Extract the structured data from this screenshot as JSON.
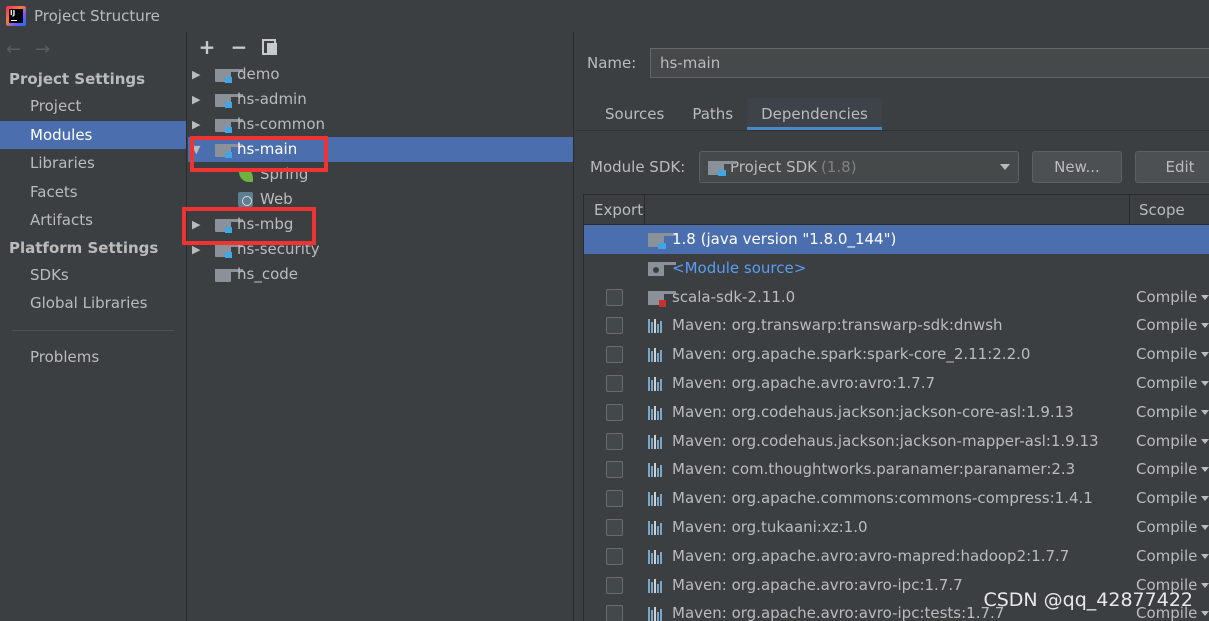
{
  "window": {
    "title": "Project Structure"
  },
  "nav": {
    "back_arrow": "←",
    "forward_arrow": "→",
    "project_settings_header": "Project Settings",
    "project_settings_items": [
      "Project",
      "Modules",
      "Libraries",
      "Facets",
      "Artifacts"
    ],
    "selected_item": "Modules",
    "platform_settings_header": "Platform Settings",
    "platform_settings_items": [
      "SDKs",
      "Global Libraries"
    ],
    "problems": "Problems"
  },
  "tree_toolbar": {
    "add": "+",
    "remove": "−"
  },
  "modules": [
    {
      "label": "demo",
      "expandable": true
    },
    {
      "label": "hs-admin",
      "expandable": true
    },
    {
      "label": "hs-common",
      "expandable": true
    },
    {
      "label": "hs-main",
      "expanded": true,
      "selected": true,
      "highlighted": true,
      "children": [
        {
          "label": "Spring",
          "icon": "spring-icon"
        },
        {
          "label": "Web",
          "icon": "web-icon"
        }
      ]
    },
    {
      "label": "hs-mbg",
      "expandable": true,
      "highlighted": true
    },
    {
      "label": "hs-security",
      "expandable": true
    },
    {
      "label": "hs_code",
      "expandable": false
    }
  ],
  "details": {
    "name_label": "Name:",
    "name_value": "hs-main",
    "tabs": [
      "Sources",
      "Paths",
      "Dependencies"
    ],
    "active_tab": "Dependencies",
    "sdk_label": "Module SDK:",
    "sdk_value": "Project SDK",
    "sdk_version": "(1.8)",
    "new_button": "New...",
    "edit_button": "Edit",
    "table": {
      "col_export": "Export",
      "col_scope": "Scope",
      "rows": [
        {
          "label": "1.8 (java version \"1.8.0_144\")",
          "icon": "jdk-folder-icon",
          "checkbox": false,
          "scope": "",
          "selected": true
        },
        {
          "label": "<Module source>",
          "icon": "source-folder-icon",
          "checkbox": false,
          "scope": "",
          "link": true
        },
        {
          "label": "scala-sdk-2.11.0",
          "icon": "library-folder-icon",
          "checkbox": true,
          "scope": "Compile"
        },
        {
          "label": "Maven: org.transwarp:transwarp-sdk:dnwsh",
          "icon": "maven-library-icon",
          "checkbox": true,
          "scope": "Compile"
        },
        {
          "label": "Maven: org.apache.spark:spark-core_2.11:2.2.0",
          "icon": "maven-library-icon",
          "checkbox": true,
          "scope": "Compile"
        },
        {
          "label": "Maven: org.apache.avro:avro:1.7.7",
          "icon": "maven-library-icon",
          "checkbox": true,
          "scope": "Compile"
        },
        {
          "label": "Maven: org.codehaus.jackson:jackson-core-asl:1.9.13",
          "icon": "maven-library-icon",
          "checkbox": true,
          "scope": "Compile"
        },
        {
          "label": "Maven: org.codehaus.jackson:jackson-mapper-asl:1.9.13",
          "icon": "maven-library-icon",
          "checkbox": true,
          "scope": "Compile"
        },
        {
          "label": "Maven: com.thoughtworks.paranamer:paranamer:2.3",
          "icon": "maven-library-icon",
          "checkbox": true,
          "scope": "Compile"
        },
        {
          "label": "Maven: org.apache.commons:commons-compress:1.4.1",
          "icon": "maven-library-icon",
          "checkbox": true,
          "scope": "Compile"
        },
        {
          "label": "Maven: org.tukaani:xz:1.0",
          "icon": "maven-library-icon",
          "checkbox": true,
          "scope": "Compile"
        },
        {
          "label": "Maven: org.apache.avro:avro-mapred:hadoop2:1.7.7",
          "icon": "maven-library-icon",
          "checkbox": true,
          "scope": "Compile"
        },
        {
          "label": "Maven: org.apache.avro:avro-ipc:1.7.7",
          "icon": "maven-library-icon",
          "checkbox": true,
          "scope": "Compile"
        },
        {
          "label": "Maven: org.apache.avro:avro-ipc:tests:1.7.7",
          "icon": "maven-library-icon",
          "checkbox": true,
          "scope": "Compile"
        }
      ]
    }
  },
  "watermark": "CSDN @qq_42877422",
  "colors": {
    "background": "#3c3f41",
    "selection": "#4b6eaf",
    "highlight_box": "#ee3333",
    "link": "#589df6"
  }
}
